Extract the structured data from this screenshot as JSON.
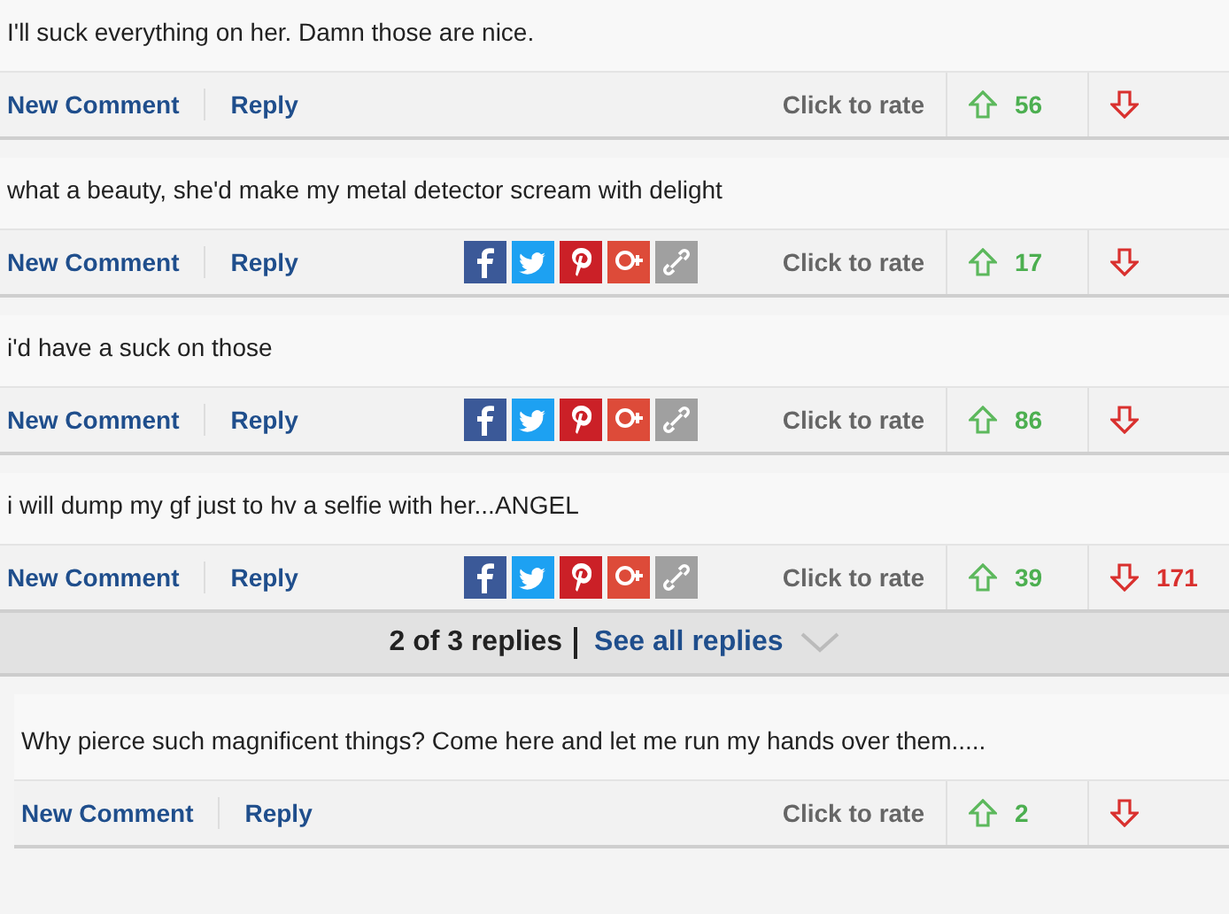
{
  "comments": [
    {
      "text": "I'll suck everything on her. Damn those are nice.",
      "new_comment": "New Comment",
      "reply": "Reply",
      "share": false,
      "rate": "Click to rate",
      "up": "56",
      "indent": false
    },
    {
      "text": "what a beauty, she'd make my metal detector scream with delight",
      "new_comment": "New Comment",
      "reply": "Reply",
      "share": true,
      "rate": "Click to rate",
      "up": "17",
      "indent": false
    },
    {
      "text": "i'd have a suck on those",
      "new_comment": "New Comment",
      "reply": "Reply",
      "share": true,
      "rate": "Click to rate",
      "up": "86",
      "indent": false
    },
    {
      "text": "i will dump my gf just to hv a selfie with her...ANGEL",
      "new_comment": "New Comment",
      "reply": "Reply",
      "share": true,
      "rate": "Click to rate",
      "up": "39",
      "down": "171",
      "indent": false,
      "replies": {
        "count": "2 of 3 replies",
        "link": "See all replies"
      }
    },
    {
      "text": "Why pierce such magnificent things? Come here and let me run my hands over them.....",
      "new_comment": "New Comment",
      "reply": "Reply",
      "share": false,
      "rate": "Click to rate",
      "up": "2",
      "indent": true
    }
  ]
}
